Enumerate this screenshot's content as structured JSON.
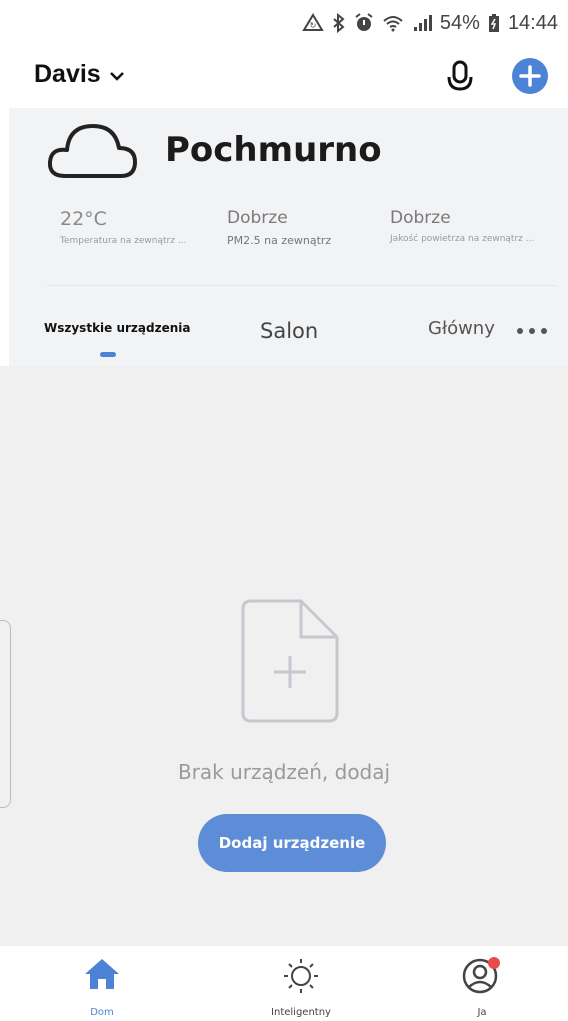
{
  "status_bar": {
    "battery_percent": "54%",
    "time": "14:44",
    "icons": [
      "data-saver-icon",
      "bluetooth-icon",
      "alarm-icon",
      "wifi-icon",
      "signal-icon",
      "battery-icon"
    ]
  },
  "header": {
    "home_name": "Davis",
    "icons": [
      "chevron-down-icon",
      "microphone-icon",
      "plus-icon"
    ],
    "accent_color": "#4d83d6"
  },
  "weather": {
    "condition": "Pochmurno",
    "icon": "cloud-icon",
    "metrics": [
      {
        "value": "22°C",
        "label": "Temperatura na zewnątrz ..."
      },
      {
        "value": "Dobrze",
        "label": "PM2.5 na zewnątrz"
      },
      {
        "value": "Dobrze",
        "label": "Jakość powietrza na zewnątrz ..."
      }
    ]
  },
  "tabs": [
    {
      "label": "Wszystkie urządzenia",
      "selected": true
    },
    {
      "label": "Salon",
      "selected": false
    },
    {
      "label": "Główny",
      "selected": false
    }
  ],
  "empty_state": {
    "icon": "add-file-icon",
    "message": "Brak urządzeń, dodaj",
    "button_label": "Dodaj urządzenie"
  },
  "bottom_nav": [
    {
      "label": "Dom",
      "icon": "home-icon",
      "active": true
    },
    {
      "label": "Inteligentny",
      "icon": "sun-icon",
      "active": false
    },
    {
      "label": "Ja",
      "icon": "user-icon",
      "active": false,
      "badge": true
    }
  ]
}
